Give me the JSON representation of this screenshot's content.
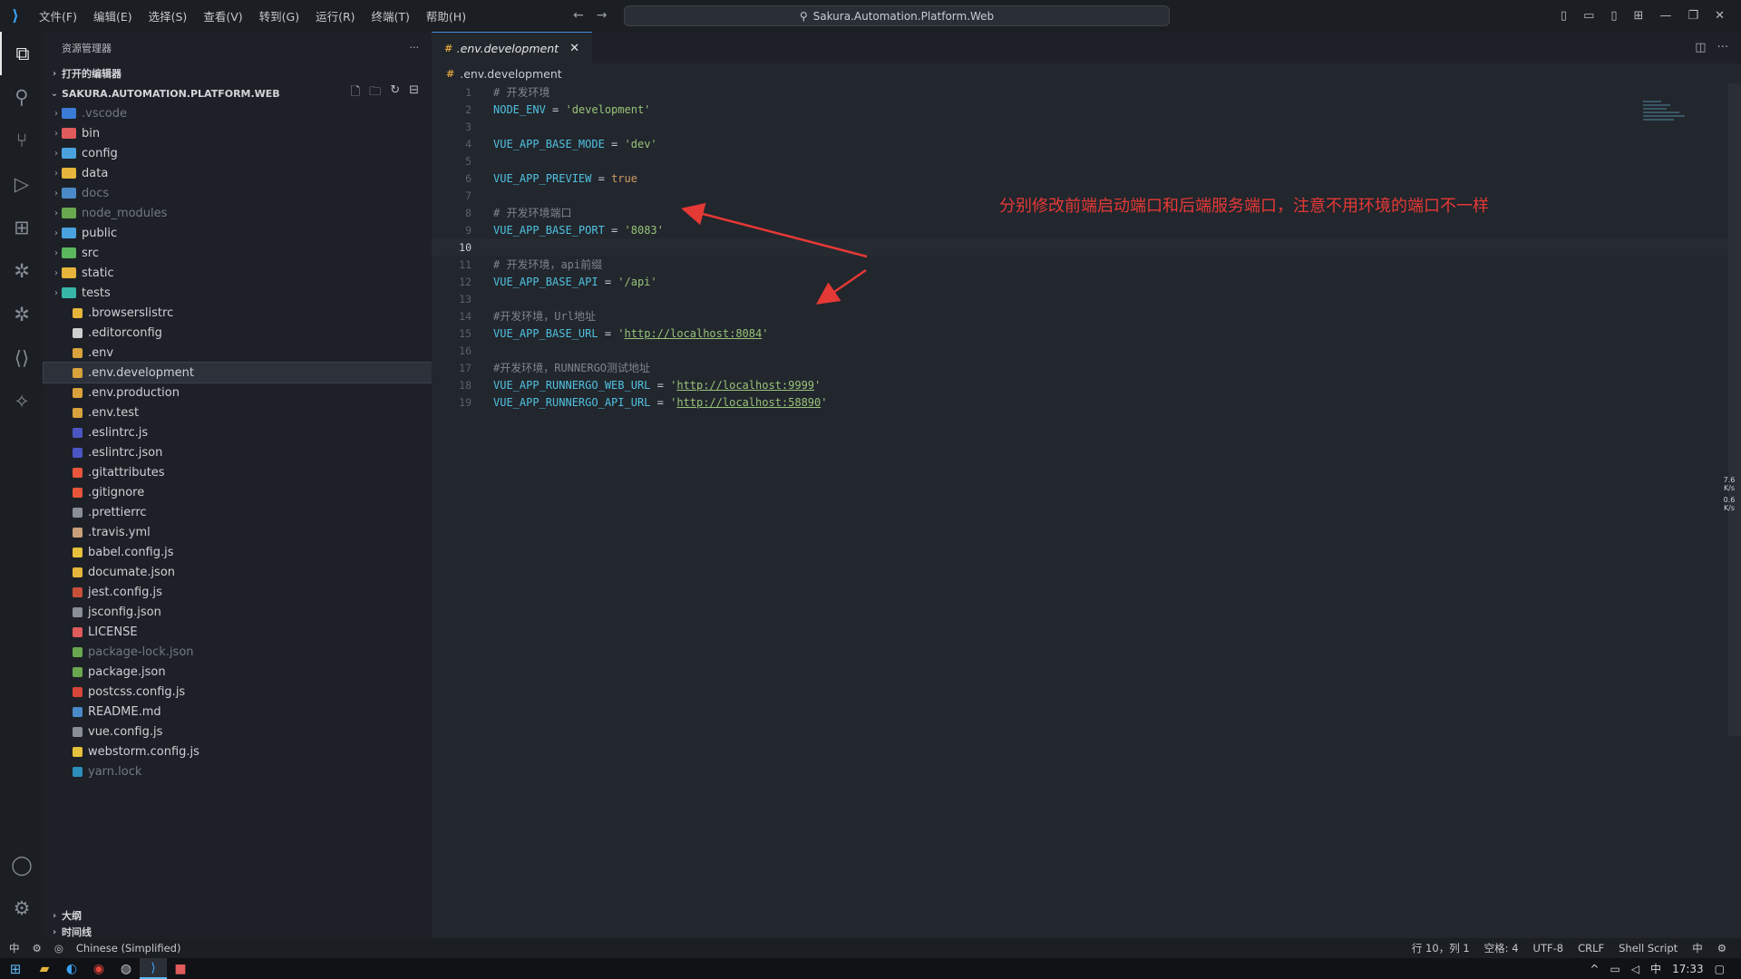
{
  "menubar": {
    "items": [
      "文件(F)",
      "编辑(E)",
      "选择(S)",
      "查看(V)",
      "转到(G)",
      "运行(R)",
      "终端(T)",
      "帮助(H)"
    ],
    "search_text": "Sakura.Automation.Platform.Web"
  },
  "explorer": {
    "title": "资源管理器",
    "open_editors": "打开的编辑器",
    "project": "SAKURA.AUTOMATION.PLATFORM.WEB",
    "folders": [
      {
        "name": ".vscode",
        "color": "#3a7bd5",
        "dim": true
      },
      {
        "name": "bin",
        "color": "#e05b5b",
        "dim": false
      },
      {
        "name": "config",
        "color": "#4aa3df",
        "dim": false
      },
      {
        "name": "data",
        "color": "#e6b53b",
        "dim": false
      },
      {
        "name": "docs",
        "color": "#4a8ac8",
        "dim": true
      },
      {
        "name": "node_modules",
        "color": "#6aa84f",
        "dim": true
      },
      {
        "name": "public",
        "color": "#4aa3df",
        "dim": false
      },
      {
        "name": "src",
        "color": "#5cb85c",
        "dim": false
      },
      {
        "name": "static",
        "color": "#e6b53b",
        "dim": false
      },
      {
        "name": "tests",
        "color": "#38b6a8",
        "dim": false
      }
    ],
    "files": [
      {
        "name": ".browserslistrc",
        "color": "#e6b53b",
        "dim": false
      },
      {
        "name": ".editorconfig",
        "color": "#cfcfcf",
        "dim": false
      },
      {
        "name": ".env",
        "color": "#d9a23d",
        "dim": false
      },
      {
        "name": ".env.development",
        "color": "#d9a23d",
        "dim": false
      },
      {
        "name": ".env.production",
        "color": "#d9a23d",
        "dim": false
      },
      {
        "name": ".env.test",
        "color": "#d9a23d",
        "dim": false
      },
      {
        "name": ".eslintrc.js",
        "color": "#4b56c4",
        "dim": false
      },
      {
        "name": ".eslintrc.json",
        "color": "#4b56c4",
        "dim": false
      },
      {
        "name": ".gitattributes",
        "color": "#e8553b",
        "dim": false
      },
      {
        "name": ".gitignore",
        "color": "#e8553b",
        "dim": false
      },
      {
        "name": ".prettierrc",
        "color": "#8a8f97",
        "dim": false
      },
      {
        "name": ".travis.yml",
        "color": "#c9a07a",
        "dim": false
      },
      {
        "name": "babel.config.js",
        "color": "#e6c13b",
        "dim": false
      },
      {
        "name": "documate.json",
        "color": "#e6b53b",
        "dim": false
      },
      {
        "name": "jest.config.js",
        "color": "#c8503b",
        "dim": false
      },
      {
        "name": "jsconfig.json",
        "color": "#8a8f97",
        "dim": false
      },
      {
        "name": "LICENSE",
        "color": "#e05b5b",
        "dim": false
      },
      {
        "name": "package-lock.json",
        "color": "#6aa84f",
        "dim": true
      },
      {
        "name": "package.json",
        "color": "#6aa84f",
        "dim": false
      },
      {
        "name": "postcss.config.js",
        "color": "#d8453b",
        "dim": false
      },
      {
        "name": "README.md",
        "color": "#4a8ac8",
        "dim": false
      },
      {
        "name": "vue.config.js",
        "color": "#8a8f97",
        "dim": false
      },
      {
        "name": "webstorm.config.js",
        "color": "#e6c13b",
        "dim": false
      },
      {
        "name": "yarn.lock",
        "color": "#2c8ebb",
        "dim": true
      }
    ],
    "selected_file": ".env.development",
    "outline": "大纲",
    "timeline": "时间线"
  },
  "editor": {
    "tab_label": ".env.development",
    "breadcrumb": ".env.development",
    "current_line": 10,
    "lines": [
      {
        "n": 1,
        "t": [
          {
            "c": "c-com",
            "s": "# 开发环境"
          }
        ]
      },
      {
        "n": 2,
        "t": [
          {
            "c": "c-key",
            "s": "NODE_ENV"
          },
          {
            "c": "c-op",
            "s": " = "
          },
          {
            "c": "c-str",
            "s": "'development'"
          }
        ]
      },
      {
        "n": 3,
        "t": []
      },
      {
        "n": 4,
        "t": [
          {
            "c": "c-key",
            "s": "VUE_APP_BASE_MODE"
          },
          {
            "c": "c-op",
            "s": " = "
          },
          {
            "c": "c-str",
            "s": "'dev'"
          }
        ]
      },
      {
        "n": 5,
        "t": []
      },
      {
        "n": 6,
        "t": [
          {
            "c": "c-key",
            "s": "VUE_APP_PREVIEW"
          },
          {
            "c": "c-op",
            "s": " = "
          },
          {
            "c": "c-bool",
            "s": "true"
          }
        ]
      },
      {
        "n": 7,
        "t": []
      },
      {
        "n": 8,
        "t": [
          {
            "c": "c-com",
            "s": "# 开发环境端口"
          }
        ]
      },
      {
        "n": 9,
        "t": [
          {
            "c": "c-key",
            "s": "VUE_APP_BASE_PORT"
          },
          {
            "c": "c-op",
            "s": " = "
          },
          {
            "c": "c-str",
            "s": "'8083'"
          }
        ]
      },
      {
        "n": 10,
        "t": []
      },
      {
        "n": 11,
        "t": [
          {
            "c": "c-com",
            "s": "# 开发环境，api前缀"
          }
        ]
      },
      {
        "n": 12,
        "t": [
          {
            "c": "c-key",
            "s": "VUE_APP_BASE_API"
          },
          {
            "c": "c-op",
            "s": " = "
          },
          {
            "c": "c-str",
            "s": "'/api'"
          }
        ]
      },
      {
        "n": 13,
        "t": []
      },
      {
        "n": 14,
        "t": [
          {
            "c": "c-com",
            "s": "#开发环境，Url地址"
          }
        ]
      },
      {
        "n": 15,
        "t": [
          {
            "c": "c-key",
            "s": "VUE_APP_BASE_URL"
          },
          {
            "c": "c-op",
            "s": " = "
          },
          {
            "c": "c-str",
            "s": "'"
          },
          {
            "c": "c-url",
            "s": "http://localhost:8084"
          },
          {
            "c": "c-str",
            "s": "'"
          }
        ]
      },
      {
        "n": 16,
        "t": []
      },
      {
        "n": 17,
        "t": [
          {
            "c": "c-com",
            "s": "#开发环境，RUNNERGO测试地址"
          }
        ]
      },
      {
        "n": 18,
        "t": [
          {
            "c": "c-key",
            "s": "VUE_APP_RUNNERGO_WEB_URL"
          },
          {
            "c": "c-op",
            "s": " = "
          },
          {
            "c": "c-str",
            "s": "'"
          },
          {
            "c": "c-url",
            "s": "http://localhost:9999"
          },
          {
            "c": "c-str",
            "s": "'"
          }
        ]
      },
      {
        "n": 19,
        "t": [
          {
            "c": "c-key",
            "s": "VUE_APP_RUNNERGO_API_URL"
          },
          {
            "c": "c-op",
            "s": " = "
          },
          {
            "c": "c-str",
            "s": "'"
          },
          {
            "c": "c-url",
            "s": "http://localhost:58890"
          },
          {
            "c": "c-str",
            "s": "'"
          }
        ]
      }
    ],
    "annotation": "分别修改前端启动端口和后端服务端口，注意不用环境的端口不一样"
  },
  "network": {
    "up": "7.6",
    "up_unit": "K/s",
    "down": "0.6",
    "down_unit": "K/s"
  },
  "statusbar": {
    "language_pack": "Chinese (Simplified)",
    "position": "行 10，列 1",
    "spaces": "空格: 4",
    "encoding": "UTF-8",
    "eol": "CRLF",
    "language": "Shell Script",
    "ime_left": "中",
    "ime_right": "中"
  },
  "taskbar": {
    "time": "17:33",
    "ime": "中"
  }
}
